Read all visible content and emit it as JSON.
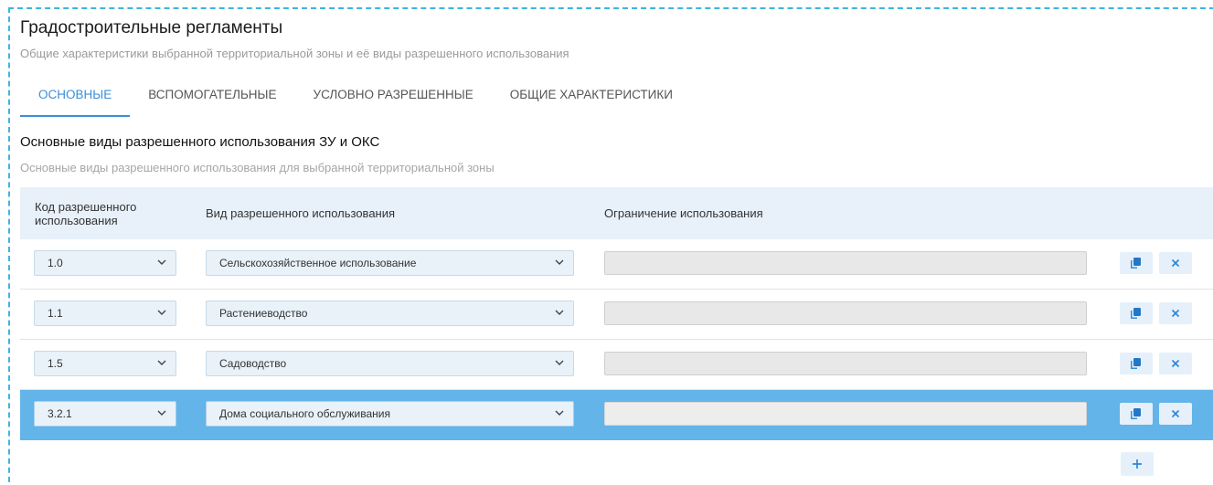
{
  "header": {
    "title": "Градостроительные регламенты",
    "subtitle": "Общие характеристики выбранной территориальной зоны и её виды разрешенного использования"
  },
  "tabs": [
    {
      "label": "ОСНОВНЫЕ",
      "active": true
    },
    {
      "label": "ВСПОМОГАТЕЛЬНЫЕ",
      "active": false
    },
    {
      "label": "УСЛОВНО РАЗРЕШЕННЫЕ",
      "active": false
    },
    {
      "label": "ОБЩИЕ ХАРАКТЕРИСТИКИ",
      "active": false
    }
  ],
  "section": {
    "title": "Основные виды разрешенного использования ЗУ и ОКС",
    "subtitle": "Основные виды разрешенного использования для выбранной территориальной зоны"
  },
  "table": {
    "columns": {
      "code": "Код разрешенного использования",
      "type": "Вид разрешенного использования",
      "restriction": "Ограничение использования"
    },
    "rows": [
      {
        "code": "1.0",
        "type": "Сельскохозяйственное использование",
        "restriction": "",
        "highlighted": false
      },
      {
        "code": "1.1",
        "type": "Растениеводство",
        "restriction": "",
        "highlighted": false
      },
      {
        "code": "1.5",
        "type": "Садоводство",
        "restriction": "",
        "highlighted": false
      },
      {
        "code": "3.2.1",
        "type": "Дома социального обслуживания",
        "restriction": "",
        "highlighted": true
      }
    ]
  },
  "icons": {
    "copy": "copy-icon",
    "delete": "close-icon",
    "add": "plus-icon",
    "dropdown": "chevron-down-icon"
  },
  "colors": {
    "accent": "#3a8fd9",
    "frame": "#3cb6e0",
    "header_bg": "#e8f1fa",
    "highlight_row": "#63b4e8",
    "button_bg": "#e6f0fa"
  }
}
